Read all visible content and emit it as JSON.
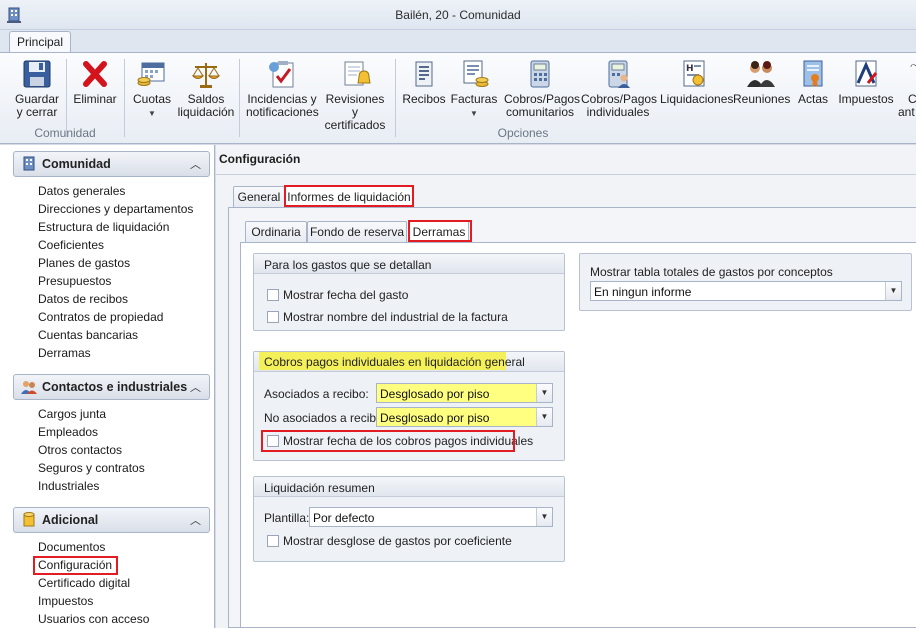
{
  "window": {
    "title": "Bailén, 20 - Comunidad"
  },
  "ribbon": {
    "tab": "Principal",
    "buttons": [
      {
        "id": "guardar",
        "label": "Guardar\ny cerrar",
        "icon": "floppy-disk-icon"
      },
      {
        "id": "eliminar",
        "label": "Eliminar",
        "icon": "red-x-icon"
      },
      {
        "id": "cuotas",
        "label": "Cuotas",
        "icon": "calendar-coins-icon",
        "dropdown": true
      },
      {
        "id": "saldos",
        "label": "Saldos\nliquidación",
        "icon": "scales-icon"
      },
      {
        "id": "incidencias",
        "label": "Incidencias y\nnotificaciones",
        "icon": "clipboard-check-icon"
      },
      {
        "id": "revisiones",
        "label": "Revisiones y\ncertificados",
        "icon": "certificate-bell-icon"
      },
      {
        "id": "recibos",
        "label": "Recibos",
        "icon": "receipt-icon"
      },
      {
        "id": "facturas",
        "label": "Facturas",
        "icon": "invoice-coins-icon",
        "dropdown": true
      },
      {
        "id": "cobrospagos",
        "label": "Cobros/Pagos\ncomunitarios",
        "icon": "calculator-icon"
      },
      {
        "id": "cobrospagosind",
        "label": "Cobros/Pagos\nindividuales",
        "icon": "calculator-person-icon"
      },
      {
        "id": "liquidaciones",
        "label": "Liquidaciones",
        "icon": "document-stamp-icon"
      },
      {
        "id": "reuniones",
        "label": "Reuniones",
        "icon": "people-meeting-icon"
      },
      {
        "id": "actas",
        "label": "Actas",
        "icon": "document-seal-icon"
      },
      {
        "id": "impuestos",
        "label": "Impuestos",
        "icon": "tax-agency-icon"
      },
      {
        "id": "cobrosant",
        "label": "C\nant",
        "icon": "partial-icon"
      }
    ],
    "groups": {
      "comunidad": "Comunidad",
      "opciones": "Opciones"
    }
  },
  "sidebar": {
    "sections": [
      {
        "title": "Comunidad",
        "icon": "building-icon",
        "items": [
          "Datos generales",
          "Direcciones y departamentos",
          "Estructura de liquidación",
          "Coeficientes",
          "Planes de gastos",
          "Presupuestos",
          "Datos de recibos",
          "Contratos de propiedad",
          "Cuentas bancarias",
          "Derramas"
        ]
      },
      {
        "title": "Contactos e industriales",
        "icon": "contacts-icon",
        "items": [
          "Cargos junta",
          "Empleados",
          "Otros contactos",
          "Seguros y contratos",
          "Industriales"
        ]
      },
      {
        "title": "Adicional",
        "icon": "database-icon",
        "items": [
          "Documentos",
          "Configuración",
          "Certificado digital",
          "Impuestos",
          "Usuarios con acceso"
        ]
      }
    ]
  },
  "main": {
    "title": "Configuración",
    "tabs": [
      "General",
      "Informes de liquidación"
    ],
    "subtabs": [
      "Ordinaria",
      "Fondo de reserva",
      "Derramas"
    ],
    "group_gastos": {
      "title": "Para los gastos que se detallan",
      "checks": [
        "Mostrar fecha del gasto",
        "Mostrar nombre del industrial de la factura"
      ]
    },
    "group_cobros": {
      "title": "Cobros pagos individuales en liquidación general",
      "asociados_label": "Asociados a recibo:",
      "asociados_value": "Desglosado por piso",
      "no_asociados_label": "No asociados a recibo:",
      "no_asociados_value": "Desglosado por piso",
      "check": "Mostrar fecha de los cobros pagos individuales"
    },
    "group_resumen": {
      "title": "Liquidación resumen",
      "plantilla_label": "Plantilla:",
      "plantilla_value": "Por defecto",
      "check": "Mostrar desglose de gastos por coeficiente"
    },
    "group_totales": {
      "title": "Mostrar tabla totales de gastos por conceptos",
      "value": "En ningun informe"
    }
  }
}
